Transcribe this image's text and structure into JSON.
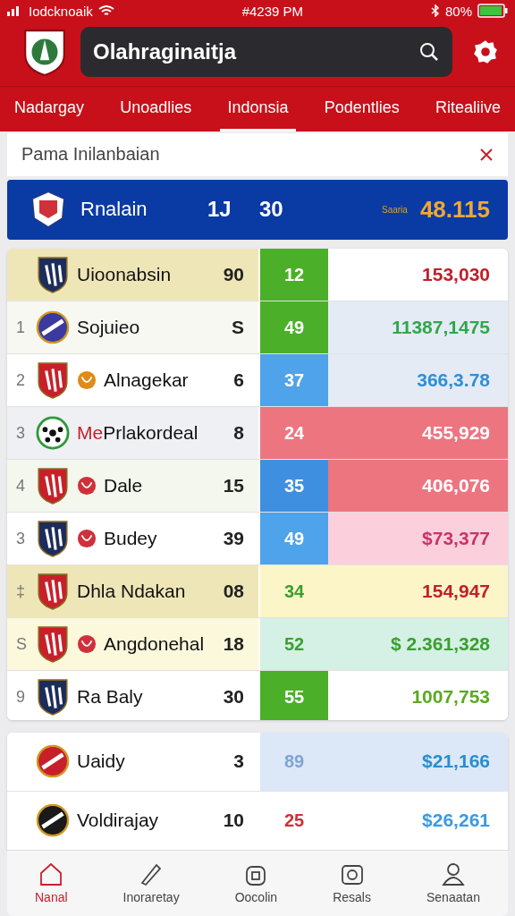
{
  "status_bar": {
    "carrier": "Iodcknoaik",
    "time": "#4239 PM",
    "battery": "80%"
  },
  "header": {
    "search": {
      "value": "Olahraginaitja"
    }
  },
  "tabs": [
    {
      "label": "Nadargay",
      "selected": false
    },
    {
      "label": "Unoadlies",
      "selected": false
    },
    {
      "label": "Indonsia",
      "selected": true
    },
    {
      "label": "Podentlies",
      "selected": false
    },
    {
      "label": "Ritealiive",
      "selected": false
    }
  ],
  "filter": {
    "label": "Pama Inilanbaian"
  },
  "banner": {
    "name": "Rnalain",
    "value_1": "1J",
    "value_2": "30",
    "caption": "Saaria",
    "amount": "48.115"
  },
  "table": {
    "rows": [
      {
        "kind": "gold",
        "crest": {
          "kind": "navy"
        },
        "name": "Uioonabsin",
        "points": "90",
        "stat": {
          "kind": "block",
          "text": "12",
          "color": "#4caf2a"
        },
        "amount": {
          "kind": "white",
          "text": "153,030",
          "color": "#c0202a"
        }
      },
      {
        "kind": "ivory",
        "rank": "1",
        "crest": {
          "kind": "disc"
        },
        "name": "Sojuieo",
        "points": "S",
        "stat": {
          "kind": "block",
          "text": "49",
          "color": "#4caf2a"
        },
        "amount": {
          "kind": "blue",
          "text": "11387,1475",
          "color": "#2fa84a"
        }
      },
      {
        "kind": "white",
        "rank": "2",
        "crest": {
          "kind": "red"
        },
        "badge": {
          "color": "#e08a18"
        },
        "name": "Alnagekar",
        "points": "6",
        "stat": {
          "kind": "block",
          "text": "37",
          "color": "#4fa3ea"
        },
        "amount": {
          "kind": "blue",
          "text": "366,3.78",
          "color": "#2e8fd6"
        }
      },
      {
        "kind": "grey",
        "rank": "3",
        "crest": {
          "kind": "ball"
        },
        "prefix": "Me",
        "name": "Prlakordeal",
        "points": "8",
        "stat": {
          "kind": "block",
          "text": "24",
          "color": "#ec7580"
        },
        "amount": {
          "kind": "red",
          "text": "455,929"
        }
      },
      {
        "kind": "mint",
        "rank": "4",
        "crest": {
          "kind": "red"
        },
        "badge": {
          "color": "#d0303a"
        },
        "name": "Dale",
        "points": "15",
        "stat": {
          "kind": "block",
          "text": "35",
          "color": "#3f8fe0"
        },
        "amount": {
          "kind": "red",
          "text": "406,076"
        }
      },
      {
        "kind": "white",
        "rank": "3",
        "crest": {
          "kind": "navy"
        },
        "badge": {
          "color": "#d0303a"
        },
        "name": "Budey",
        "points": "39",
        "stat": {
          "kind": "block",
          "text": "49",
          "color": "#4fa3ea"
        },
        "amount": {
          "kind": "pink",
          "text": "$73,377",
          "color": "#c8336a"
        }
      },
      {
        "kind": "gold",
        "rank": "‡",
        "crest": {
          "kind": "red"
        },
        "name": "Dhla Ndakan",
        "points": "08",
        "stat": {
          "kind": "plain",
          "text": "34",
          "color": "#3aa030"
        },
        "amount": {
          "kind": "yellow",
          "text": "154,947",
          "color": "#c0202a"
        }
      },
      {
        "kind": "cream",
        "rank": "S",
        "crest": {
          "kind": "red"
        },
        "badge": {
          "color": "#d0303a"
        },
        "name": "Angdonehal",
        "points": "18",
        "stat": {
          "kind": "plain",
          "text": "52",
          "color": "#3aa030"
        },
        "amount": {
          "kind": "green",
          "text": "$ 2.361,328",
          "color": "#3aa030"
        }
      },
      {
        "kind": "white",
        "rank": "9",
        "crest": {
          "kind": "navy"
        },
        "name": "Ra Baly",
        "points": "30",
        "stat": {
          "kind": "block",
          "text": "55",
          "color": "#4caf2a"
        },
        "amount": {
          "kind": "white",
          "text": "1007,753",
          "color": "#5aaa20"
        }
      }
    ]
  },
  "table_2": {
    "rows": [
      {
        "kind": "white",
        "crest": {
          "kind": "red-disc"
        },
        "name": "Uaidy",
        "points": "3",
        "stat": {
          "kind": "plain",
          "text": "89",
          "color": "#7fa4d4"
        },
        "amount": {
          "kind": "sky",
          "text": "$21,166",
          "color": "#2a8ecc"
        }
      },
      {
        "kind": "white",
        "crest": {
          "kind": "dark-disc"
        },
        "name": "Voldirajay",
        "points": "10",
        "stat": {
          "kind": "plain",
          "text": "25",
          "color": "#d0303a"
        },
        "amount": {
          "kind": "white",
          "text": "$26,261",
          "color": "#3a9ae0"
        }
      }
    ]
  },
  "bottom_nav": [
    {
      "label": "Nanal",
      "kind": "home",
      "selected": true
    },
    {
      "label": "Inoraretay",
      "kind": "pencil",
      "selected": false
    },
    {
      "label": "Oocolin",
      "kind": "box",
      "selected": false
    },
    {
      "label": "Resals",
      "kind": "photo",
      "selected": false
    },
    {
      "label": "Senaatan",
      "kind": "person",
      "selected": false
    }
  ]
}
